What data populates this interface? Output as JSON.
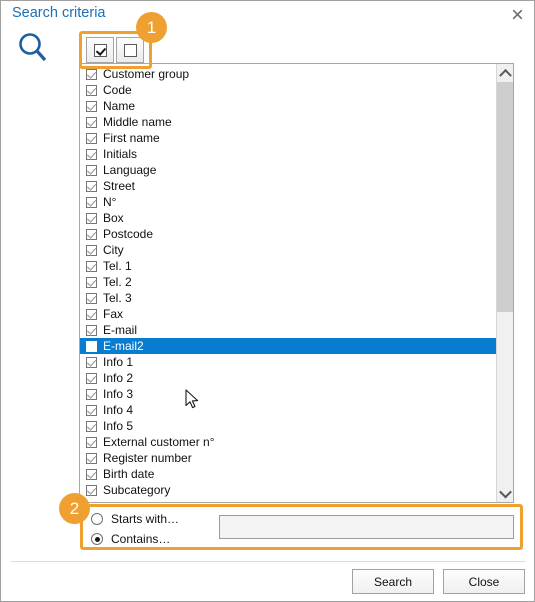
{
  "window": {
    "title": "Search criteria",
    "close_icon": "close-icon",
    "search_icon": "magnifier-icon"
  },
  "toolbar": {
    "check_all_label": "",
    "uncheck_all_label": "",
    "check_all_icon": "checked-box-icon",
    "uncheck_all_icon": "empty-box-icon"
  },
  "annotations": [
    {
      "badge": "1",
      "target": "select-all-toolbar"
    },
    {
      "badge": "2",
      "target": "match-mode-group"
    }
  ],
  "field_list": {
    "items": [
      {
        "label": "Customer group",
        "checked": true,
        "selected": false
      },
      {
        "label": "Code",
        "checked": true,
        "selected": false
      },
      {
        "label": "Name",
        "checked": true,
        "selected": false
      },
      {
        "label": "Middle name",
        "checked": true,
        "selected": false
      },
      {
        "label": "First name",
        "checked": true,
        "selected": false
      },
      {
        "label": "Initials",
        "checked": true,
        "selected": false
      },
      {
        "label": "Language",
        "checked": true,
        "selected": false
      },
      {
        "label": "Street",
        "checked": true,
        "selected": false
      },
      {
        "label": "N°",
        "checked": true,
        "selected": false
      },
      {
        "label": "Box",
        "checked": true,
        "selected": false
      },
      {
        "label": "Postcode",
        "checked": true,
        "selected": false
      },
      {
        "label": "City",
        "checked": true,
        "selected": false
      },
      {
        "label": "Tel. 1",
        "checked": true,
        "selected": false
      },
      {
        "label": "Tel. 2",
        "checked": true,
        "selected": false
      },
      {
        "label": "Tel. 3",
        "checked": true,
        "selected": false
      },
      {
        "label": "Fax",
        "checked": true,
        "selected": false
      },
      {
        "label": "E-mail",
        "checked": true,
        "selected": false
      },
      {
        "label": "E-mail2",
        "checked": false,
        "selected": true
      },
      {
        "label": "Info 1",
        "checked": true,
        "selected": false
      },
      {
        "label": "Info 2",
        "checked": true,
        "selected": false
      },
      {
        "label": "Info 3",
        "checked": true,
        "selected": false
      },
      {
        "label": "Info 4",
        "checked": true,
        "selected": false
      },
      {
        "label": "Info 5",
        "checked": true,
        "selected": false
      },
      {
        "label": "External customer n°",
        "checked": true,
        "selected": false
      },
      {
        "label": "Register number",
        "checked": true,
        "selected": false
      },
      {
        "label": "Birth date",
        "checked": true,
        "selected": false
      },
      {
        "label": "Subcategory",
        "checked": true,
        "selected": false
      }
    ],
    "scrollbar": {
      "up_icon": "chevron-up-icon",
      "down_icon": "chevron-down-icon"
    }
  },
  "match_mode": {
    "options": [
      {
        "label": "Starts with…",
        "selected": false
      },
      {
        "label": "Contains…",
        "selected": true
      }
    ],
    "input_value": "",
    "input_placeholder": ""
  },
  "footer": {
    "search_label": "Search",
    "close_label": "Close"
  },
  "colors": {
    "title": "#1a6fb5",
    "selection": "#0A7CD0",
    "annotation": "#F0A030",
    "icon": "#1F5FA0"
  }
}
